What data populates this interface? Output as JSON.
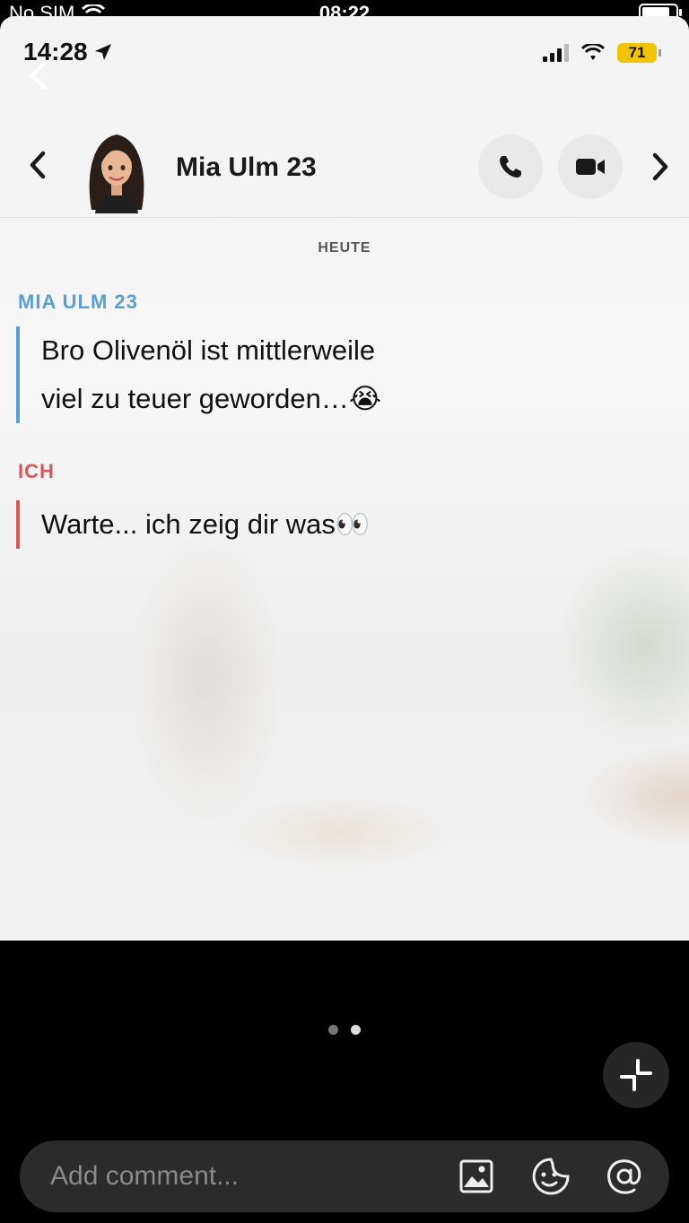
{
  "device_status": {
    "carrier": "No SIM",
    "time": "08:22"
  },
  "app_status": {
    "time": "14:28",
    "battery": "71"
  },
  "chat_header": {
    "contact_name": "Mia Ulm 23",
    "icons": [
      "chevron-left-icon",
      "phone-icon",
      "video-camera-icon",
      "chevron-right-icon"
    ]
  },
  "chat": {
    "day_label": "HEUTE",
    "messages": [
      {
        "sender": "MIA ULM 23",
        "lines": [
          "Bro Olivenöl ist mittlerweile",
          "viel zu teuer geworden…😭"
        ]
      },
      {
        "sender": "ICH",
        "lines": [
          "Warte... ich zeig dir was👀"
        ]
      }
    ]
  },
  "pager": {
    "current": 2,
    "total": 2
  },
  "comment_bar": {
    "placeholder": "Add comment...",
    "icons": [
      "gallery-icon",
      "sticker-icon",
      "mention-icon"
    ]
  },
  "colors": {
    "mia_accent": "#5a9fd4",
    "me_accent": "#d25a5a",
    "battery_yellow": "#f2c400"
  }
}
